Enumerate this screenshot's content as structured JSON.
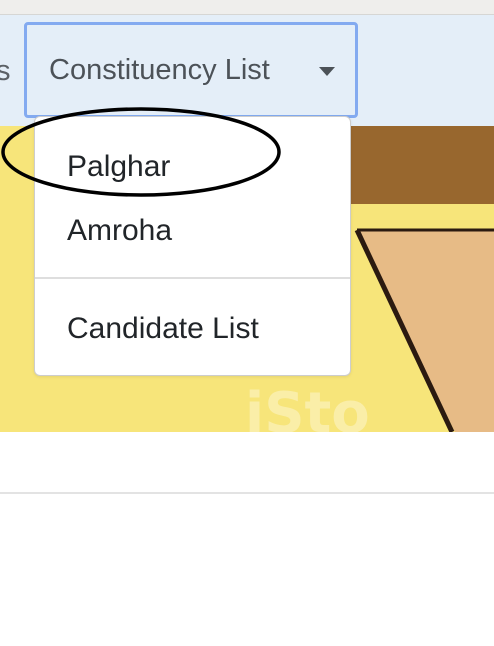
{
  "navbar": {
    "prev_item_fragment": "s",
    "dropdown": {
      "label": "Constituency List",
      "caret_icon": "caret-down-icon",
      "items": [
        {
          "label": "Palghar"
        },
        {
          "label": "Amroha"
        },
        {
          "label": "Candidate List"
        }
      ]
    }
  },
  "banner": {
    "watermark_fragment": "iSto"
  },
  "colors": {
    "navbar_bg": "#e4eef8",
    "focus_ring": "#83aaf0",
    "banner_yellow": "#f7e57a",
    "banner_brown": "#98672e",
    "banner_tan": "#e7bb86",
    "annotation_oval": "#000000"
  }
}
